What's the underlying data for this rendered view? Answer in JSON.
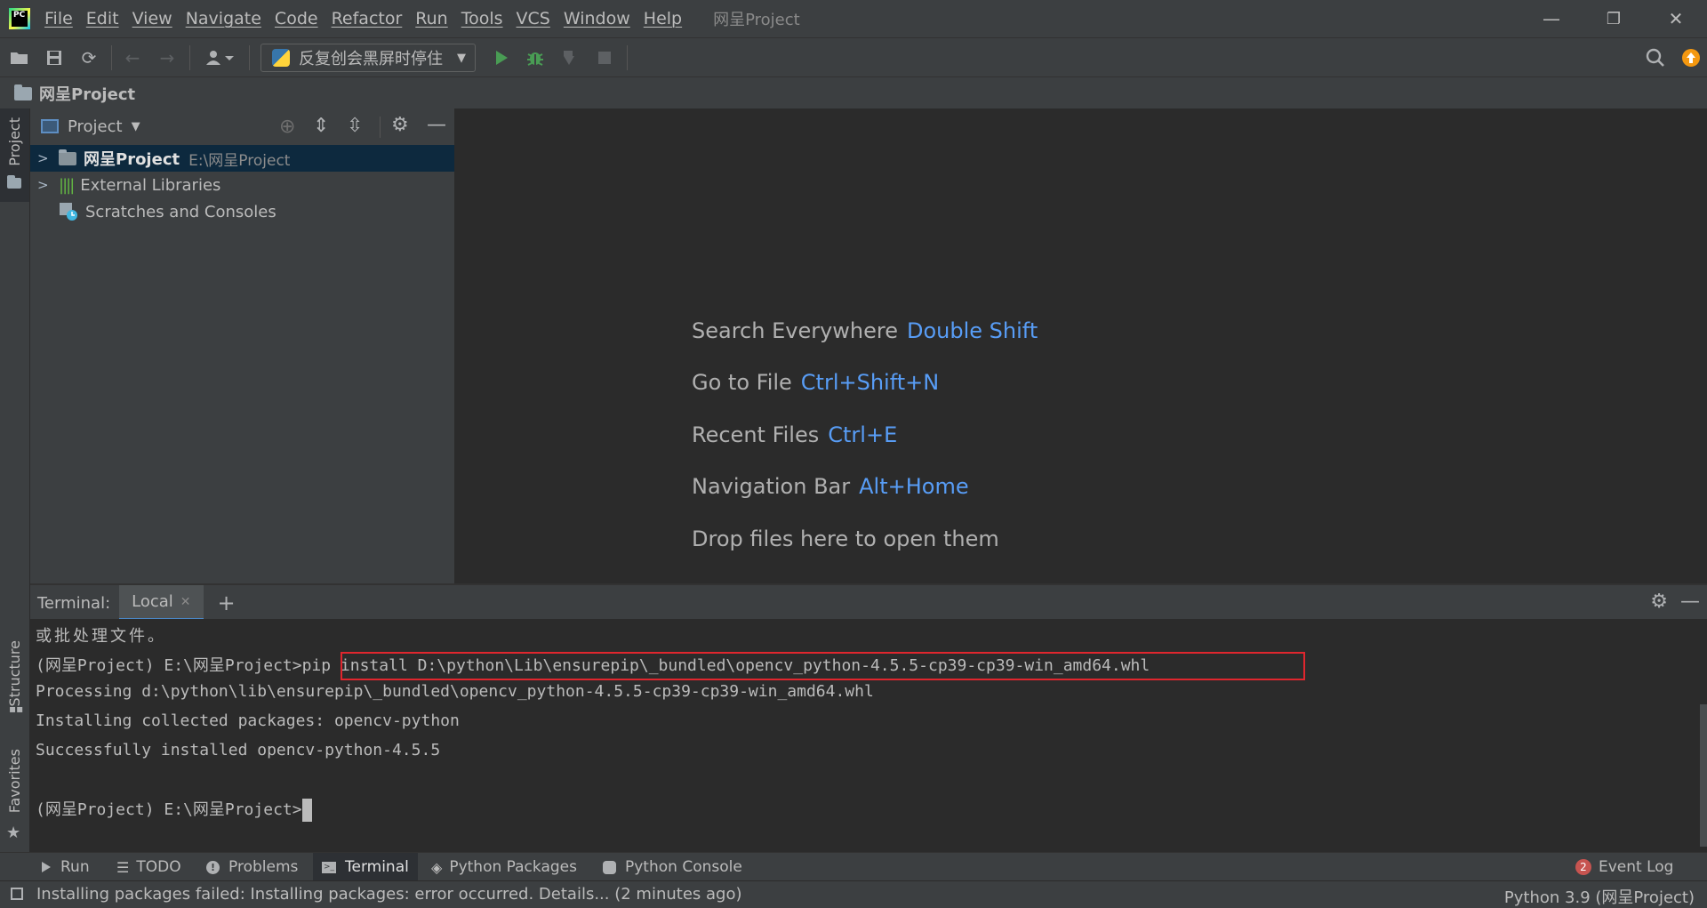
{
  "menu": {
    "file": "File",
    "edit": "Edit",
    "view": "View",
    "navigate": "Navigate",
    "code": "Code",
    "refactor": "Refactor",
    "run": "Run",
    "tools": "Tools",
    "vcs": "VCS",
    "window": "Window",
    "help": "Help"
  },
  "window_title": "网呈Project",
  "app_logo": "PC",
  "toolbar": {
    "run_config": "反复创会黑屏时停住"
  },
  "breadcrumb": {
    "project": "网呈Project"
  },
  "left_stripe": {
    "project": "Project",
    "structure": "Structure",
    "favorites": "Favorites"
  },
  "project_panel": {
    "title": "Project",
    "tree": [
      {
        "label": "网呈Project",
        "path": "E:\\网呈Project"
      },
      {
        "label": "External Libraries"
      },
      {
        "label": "Scratches and Consoles"
      }
    ]
  },
  "welcome": [
    {
      "text": "Search Everywhere",
      "key": "Double Shift"
    },
    {
      "text": "Go to File",
      "key": "Ctrl+Shift+N"
    },
    {
      "text": "Recent Files",
      "key": "Ctrl+E"
    },
    {
      "text": "Navigation Bar",
      "key": "Alt+Home"
    },
    {
      "text": "Drop files here to open them",
      "key": ""
    }
  ],
  "terminal": {
    "label": "Terminal:",
    "tab": "Local",
    "lines": [
      "或批处理文件。",
      "(网呈Project) E:\\网呈Project>",
      "Processing d:\\python\\lib\\ensurepip\\_bundled\\opencv_python-4.5.5-cp39-cp39-win_amd64.whl",
      "Installing collected packages: opencv-python",
      "Successfully installed opencv-python-4.5.5",
      "",
      "(网呈Project) E:\\网呈Project>"
    ],
    "command": "pip install D:\\python\\Lib\\ensurepip\\_bundled\\opencv_python-4.5.5-cp39-cp39-win_amd64.whl"
  },
  "bottom_tools": {
    "run": "Run",
    "todo": "TODO",
    "problems": "Problems",
    "terminal": "Terminal",
    "python_packages": "Python Packages",
    "python_console": "Python Console",
    "event_log": "Event Log",
    "event_count": "2"
  },
  "status": {
    "message": "Installing packages failed: Installing packages: error occurred. Details... (2 minutes ago)",
    "interpreter": "Python 3.9 (网呈Project)"
  },
  "colors": {
    "accent_link": "#589df6",
    "highlight_box": "#e0262e",
    "run_green": "#499c54"
  }
}
